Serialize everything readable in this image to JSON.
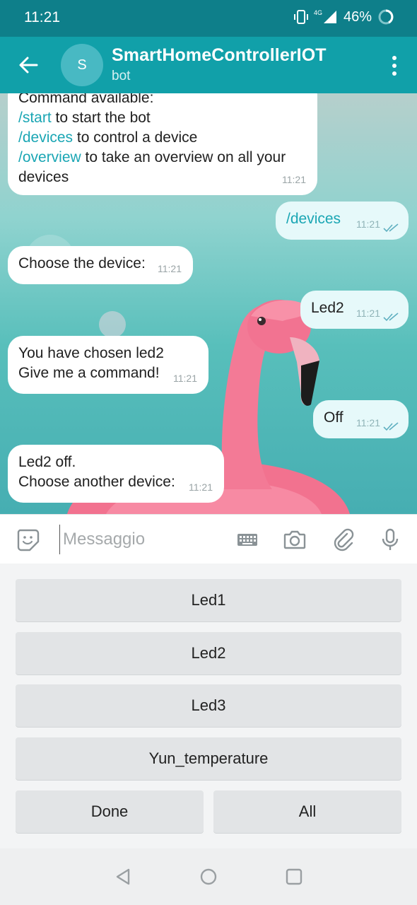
{
  "status_bar": {
    "time": "11:21",
    "network": "4G",
    "battery": "46%"
  },
  "header": {
    "avatar_letter": "S",
    "title": "SmartHomeControllerIOT",
    "subtitle": "bot"
  },
  "messages": {
    "m1": {
      "lines": [
        "Command available:"
      ],
      "cmd_start": "/start",
      "txt_start": " to start the bot",
      "cmd_devices": "/devices",
      "txt_devices": " to control a device",
      "cmd_overview": "/overview",
      "txt_overview": " to take an overview on all your",
      "txt_devices_end": "devices",
      "time": "11:21"
    },
    "m2": {
      "text": "/devices",
      "time": "11:21"
    },
    "m3": {
      "text": "Choose the device:",
      "time": "11:21"
    },
    "m4": {
      "text": "Led2",
      "time": "11:21"
    },
    "m5": {
      "line1": "You have chosen led2",
      "line2": "Give me a command!",
      "time": "11:21"
    },
    "m6": {
      "text": "Off",
      "time": "11:21"
    },
    "m7": {
      "line1": "Led2 off.",
      "line2": "Choose another device:",
      "time": "11:21"
    }
  },
  "input": {
    "placeholder": "Messaggio"
  },
  "keyboard": {
    "led1": "Led1",
    "led2": "Led2",
    "led3": "Led3",
    "yun": "Yun_temperature",
    "done": "Done",
    "all": "All"
  },
  "colors": {
    "status_bar": "#0e7f8a",
    "app_bar": "#11a0a9",
    "accent": "#1aa6b4",
    "flamingo": "#f07a95"
  }
}
